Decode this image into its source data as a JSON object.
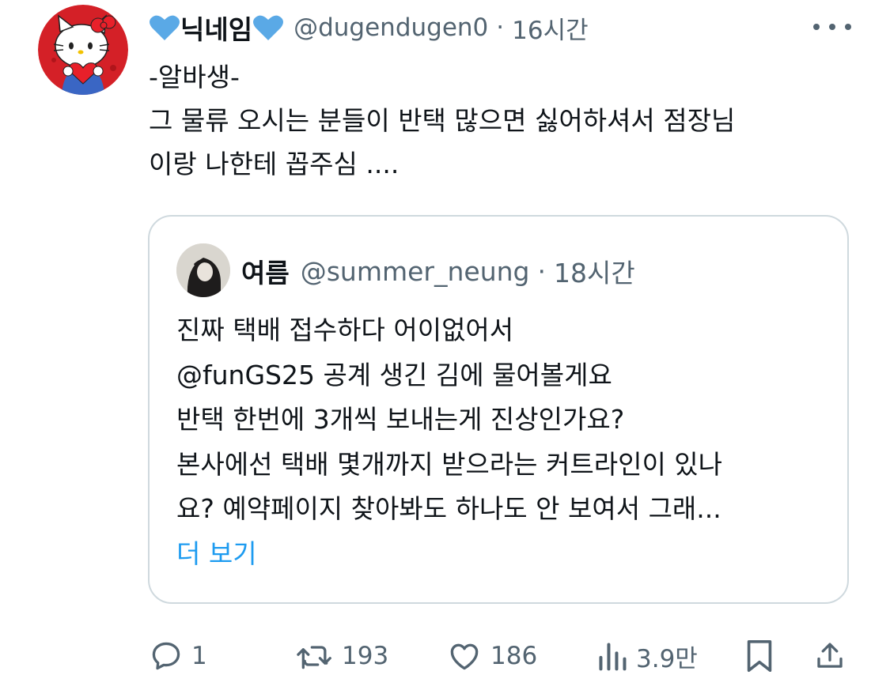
{
  "tweet": {
    "display_name": "닉네임",
    "handle": "@dugendugen0",
    "time": "16시간",
    "separator": "·",
    "lines": [
      "-알바생-",
      "그 물류 오시는 분들이 반택 많으면 싫어하셔서 점장님",
      "이랑 나한테 꼽주심 ...."
    ]
  },
  "quote": {
    "display_name": "여름",
    "handle": "@summer_neung",
    "time": "18시간",
    "separator": "·",
    "lines": [
      "진짜 택배 접수하다 어이없어서",
      "@funGS25 공계 생긴 김에 물어볼게요",
      "반택 한번에 3개씩 보내는게 진상인가요?",
      "본사에선 택배 몇개까지 받으라는 커트라인이 있나",
      "요? 예약페이지 찾아봐도 하나도 안 보여서 그래..."
    ],
    "show_more": "더 보기"
  },
  "actions": {
    "reply_count": "1",
    "retweet_count": "193",
    "like_count": "186",
    "view_count": "3.9만"
  },
  "colors": {
    "text": "#0f1419",
    "secondary": "#536471",
    "accent": "#1d9bf0",
    "heart": "#5aa9e6",
    "border": "#cfd9de",
    "avatar_red": "#d42027"
  },
  "icons": {
    "reply": "comment-bubble-icon",
    "retweet": "retweet-icon",
    "like": "heart-outline-icon",
    "views": "bar-chart-icon",
    "bookmark": "bookmark-icon",
    "share": "share-icon",
    "more": "more-dots-icon"
  }
}
